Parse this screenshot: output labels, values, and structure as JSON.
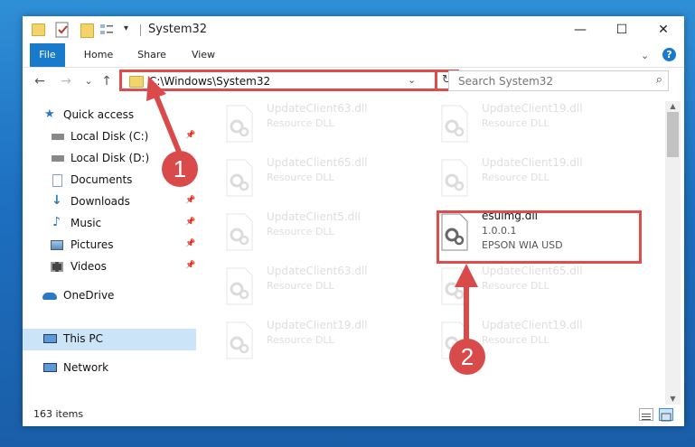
{
  "window": {
    "title": "System32",
    "controls": {
      "minimize": "—",
      "maximize": "☐",
      "close": "✕"
    }
  },
  "ribbon": {
    "tabs": [
      "File",
      "Home",
      "Share",
      "View"
    ],
    "help": "?"
  },
  "nav": {
    "back": "←",
    "forward": "→",
    "recent": "⌄",
    "up": "↑",
    "address": "C:\\Windows\\System32",
    "search_placeholder": "Search System32"
  },
  "sidebar": {
    "items": [
      {
        "label": "Quick access",
        "icon": "star-icon",
        "pinned": false
      },
      {
        "label": "Local Disk (C:)",
        "icon": "drive-icon",
        "pinned": true
      },
      {
        "label": "Local Disk (D:)",
        "icon": "drive-icon",
        "pinned": false
      },
      {
        "label": "Documents",
        "icon": "documents-icon",
        "pinned": true
      },
      {
        "label": "Downloads",
        "icon": "downloads-icon",
        "pinned": true
      },
      {
        "label": "Music",
        "icon": "music-icon",
        "pinned": true
      },
      {
        "label": "Pictures",
        "icon": "pictures-icon",
        "pinned": true
      },
      {
        "label": "Videos",
        "icon": "videos-icon",
        "pinned": true
      },
      {
        "label": "OneDrive",
        "icon": "onedrive-icon",
        "pinned": false
      },
      {
        "label": "This PC",
        "icon": "computer-icon",
        "pinned": false,
        "selected": true
      },
      {
        "label": "Network",
        "icon": "network-icon",
        "pinned": false
      }
    ]
  },
  "files": [
    {
      "name": "UpdateClient63.dll",
      "desc": "Resource DLL"
    },
    {
      "name": "UpdateClient19.dll",
      "desc": "Resource DLL"
    },
    {
      "name": "UpdateClient65.dll",
      "desc": "Resource DLL"
    },
    {
      "name": "UpdateClient19.dll",
      "desc": "Resource DLL"
    },
    {
      "name": "UpdateClient5.dll",
      "desc": "Resource DLL"
    },
    {
      "name": "esuimg.dll",
      "version": "1.0.0.1",
      "desc": "EPSON WIA USD",
      "highlighted": true
    },
    {
      "name": "UpdateClient63.dll",
      "desc": "Resource DLL"
    },
    {
      "name": "UpdateClient65.dll",
      "desc": "Resource DLL"
    },
    {
      "name": "UpdateClient19.dll",
      "desc": "Resource DLL"
    },
    {
      "name": "UpdateClient19.dll",
      "desc": "Resource DLL"
    }
  ],
  "status": {
    "item_count": "163 items"
  },
  "annotations": {
    "step1": "1",
    "step2": "2"
  },
  "colors": {
    "accent": "#1979ca",
    "annotation": "#d94b4b",
    "desktop": "#1d6fc0",
    "selected": "#cce4f7"
  }
}
